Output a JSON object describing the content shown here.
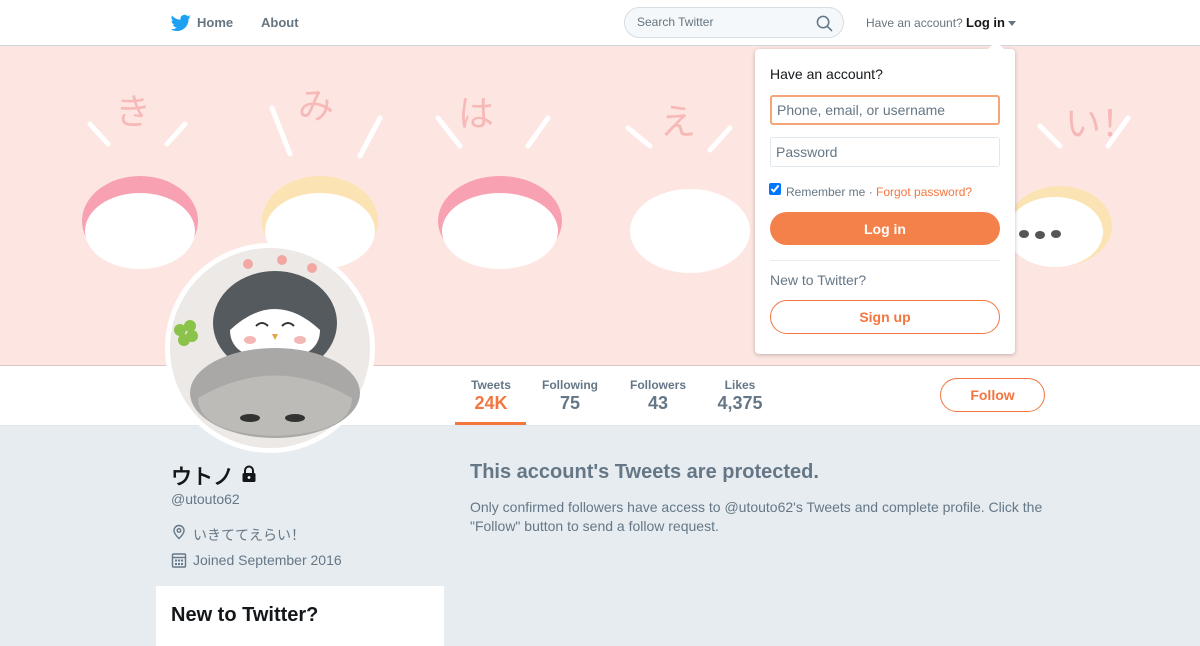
{
  "colors": {
    "accent": "#f4763f",
    "background": "#e6ecf0",
    "banner": "#fde6e1"
  },
  "topbar": {
    "home_label": "Home",
    "about_label": "About",
    "search_placeholder": "Search Twitter",
    "have_account": "Have an account?",
    "login_label": "Log in"
  },
  "profile": {
    "name": "ウトノ",
    "handle": "@utouto62",
    "location": "いきててえらい！",
    "joined": "Joined September 2016",
    "protected_title": "This account's Tweets are protected.",
    "protected_text": "Only confirmed followers have access to @utouto62's Tweets and complete profile. Click the \"Follow\" button to send a follow request.",
    "follow_label": "Follow",
    "new_to_twitter": "New to Twitter?"
  },
  "stats": [
    {
      "label": "Tweets",
      "value": "24K"
    },
    {
      "label": "Following",
      "value": "75"
    },
    {
      "label": "Followers",
      "value": "43"
    },
    {
      "label": "Likes",
      "value": "4,375"
    }
  ],
  "login_dropdown": {
    "heading": "Have an account?",
    "username_placeholder": "Phone, email, or username",
    "password_placeholder": "Password",
    "remember_me": "Remember me ·",
    "forgot_password": "Forgot password?",
    "login_button": "Log in",
    "new_heading": "New to Twitter?",
    "signup_button": "Sign up"
  },
  "icons": [
    "twitter-bird-icon",
    "search-icon",
    "caret-down-icon",
    "lock-icon",
    "location-pin-icon",
    "calendar-icon"
  ]
}
